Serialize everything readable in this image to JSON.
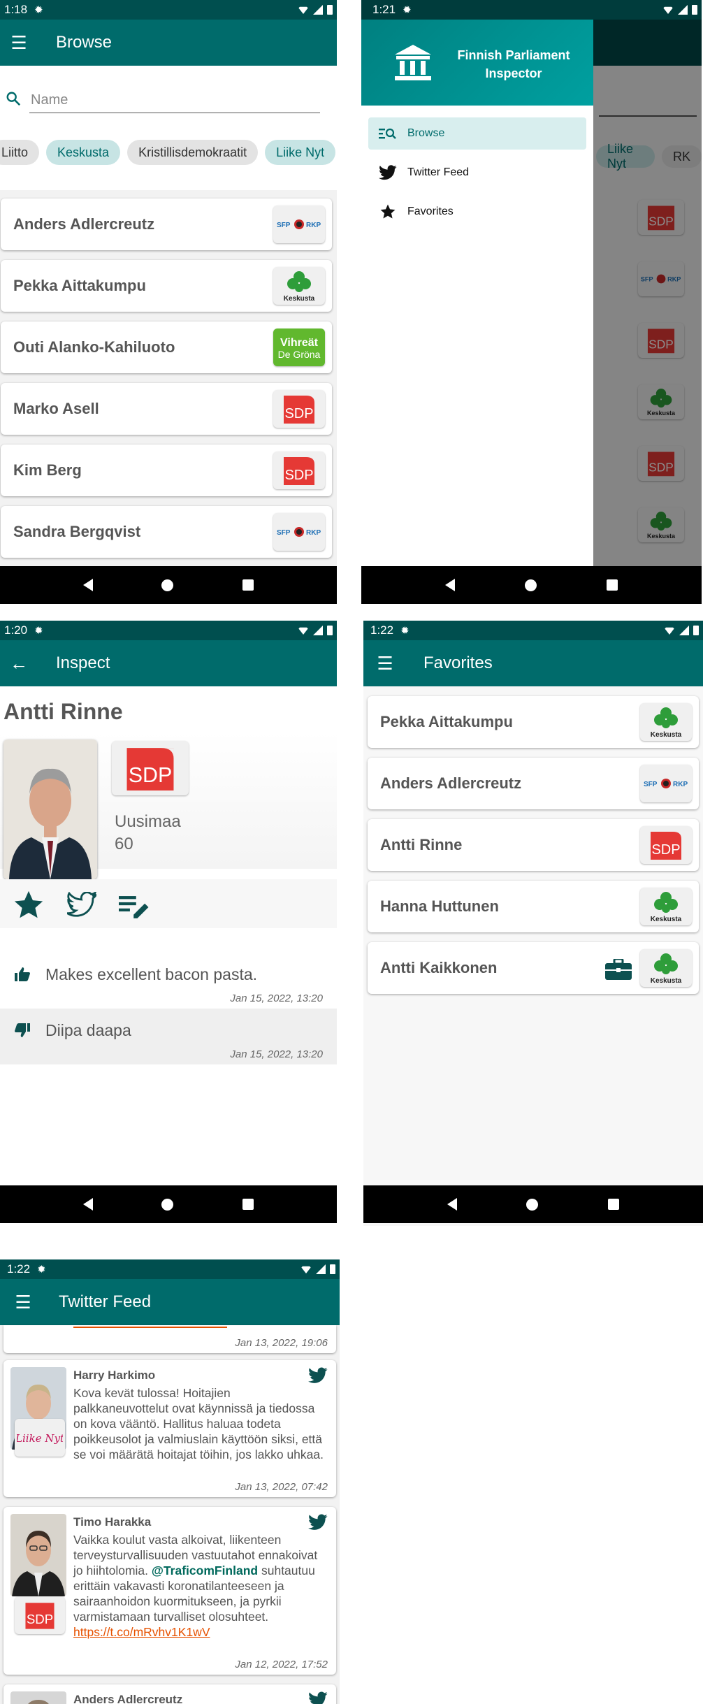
{
  "screens": {
    "browse": {
      "time": "1:18",
      "title": "Browse",
      "search_placeholder": "Name",
      "chips": [
        {
          "label": "Liitto",
          "selected": false
        },
        {
          "label": "Keskusta",
          "selected": true
        },
        {
          "label": "Kristillisdemokraatit",
          "selected": false
        },
        {
          "label": "Liike Nyt",
          "selected": true
        }
      ],
      "members": [
        {
          "name": "Anders Adlercreutz",
          "party": "SFP RKP"
        },
        {
          "name": "Pekka Aittakumpu",
          "party": "Keskusta"
        },
        {
          "name": "Outi Alanko-Kahiluoto",
          "party": "Vihreät De Gröna"
        },
        {
          "name": "Marko Asell",
          "party": "SDP"
        },
        {
          "name": "Kim Berg",
          "party": "SDP"
        },
        {
          "name": "Sandra Bergqvist",
          "party": "SFP RKP"
        }
      ]
    },
    "drawer": {
      "time": "1:21",
      "header_line1": "Finnish Parliament",
      "header_line2": "Inspector",
      "items": [
        {
          "label": "Browse",
          "icon": "browse-icon",
          "selected": true
        },
        {
          "label": "Twitter Feed",
          "icon": "twitter-icon",
          "selected": false
        },
        {
          "label": "Favorites",
          "icon": "star-icon",
          "selected": false
        }
      ],
      "background_chips": [
        "Liike Nyt",
        "RK"
      ]
    },
    "inspect": {
      "time": "1:20",
      "title": "Inspect",
      "name": "Antti Rinne",
      "party": "SDP",
      "constituency": "Uusimaa",
      "seat_number": "60",
      "notes": [
        {
          "type": "thumb-up",
          "text": "Makes excellent bacon pasta.",
          "date": "Jan 15, 2022, 13:20"
        },
        {
          "type": "thumb-down",
          "text": "Diipa daapa",
          "date": "Jan 15, 2022, 13:20"
        }
      ]
    },
    "favorites": {
      "time": "1:22",
      "title": "Favorites",
      "members": [
        {
          "name": "Pekka Aittakumpu",
          "party": "Keskusta",
          "minister": false
        },
        {
          "name": "Anders Adlercreutz",
          "party": "SFP RKP",
          "minister": false
        },
        {
          "name": "Antti Rinne",
          "party": "SDP",
          "minister": false
        },
        {
          "name": "Hanna Huttunen",
          "party": "Keskusta",
          "minister": false
        },
        {
          "name": "Antti Kaikkonen",
          "party": "Keskusta",
          "minister": true
        }
      ]
    },
    "twitter": {
      "time": "1:22",
      "title": "Twitter Feed",
      "partial_top_date": "Jan 13, 2022, 19:06",
      "tweets": [
        {
          "author": "Harry Harkimo",
          "party": "Liike Nyt",
          "text": "Kova kevät tulossa! Hoitajien palkkaneuvottelut ovat käynnissä ja tiedossa on kova vääntö. Hallitus haluaa todeta poikkeusolot ja valmiuslain käyttöön siksi, että se voi määrätä hoitajat töihin, jos lakko uhkaa.",
          "date": "Jan 13, 2022, 07:42"
        },
        {
          "author": "Timo Harakka",
          "party": "SDP",
          "text_before": "Vaikka koulut vasta alkoivat, liikenteen terveysturvallisuuden vastuutahot ennakoivat jo hiihtolomia.",
          "mention": "@TraficomFinland",
          "text_after": "suhtautuu erittäin vakavasti koronatilanteeseen ja sairaanhoidon kuormitukseen, ja pyrkii varmistamaan turvalliset olosuhteet.",
          "link": "https://t.co/mRvhv1K1wV",
          "date": "Jan 12, 2022, 17:52"
        },
        {
          "author": "Anders Adlercreutz"
        }
      ]
    }
  },
  "colors": {
    "appbar": "#006b6b",
    "statusbar": "#004f4f",
    "sdp_red": "#e53935",
    "keskusta_green": "#2e7d32",
    "vihreat_green": "#61b82e"
  }
}
